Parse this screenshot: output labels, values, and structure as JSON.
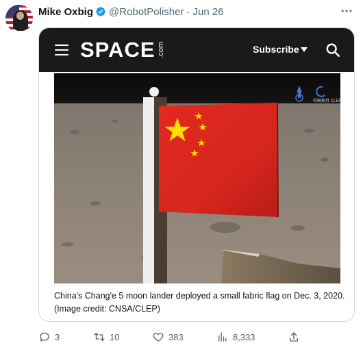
{
  "tweet": {
    "author_name": "Mike Oxbig",
    "handle": "@RobotPolisher",
    "dot": "·",
    "date": "Jun 26"
  },
  "card": {
    "site_logo": "SPACE",
    "site_logo_suffix": ".com",
    "subscribe_label": "Subscribe",
    "caption": "China's Chang'e 5 moon lander deployed a small fabric flag on Dec. 3, 2020. (Image credit: CNSA/CLEP)",
    "watermark_label": "中国探月 CLEP"
  },
  "actions": {
    "replies": "3",
    "reposts": "10",
    "likes": "383",
    "views": "8,333"
  },
  "colors": {
    "verified": "#1d9bf0",
    "site_bar": "#1a1a1a",
    "flag_red": "#d7261e",
    "star_yellow": "#ffde00",
    "muted_text": "#536471"
  },
  "icons": [
    "verified-badge-icon",
    "more-icon",
    "hamburger-icon",
    "search-icon",
    "reply-icon",
    "repost-icon",
    "like-icon",
    "views-icon",
    "share-icon"
  ]
}
